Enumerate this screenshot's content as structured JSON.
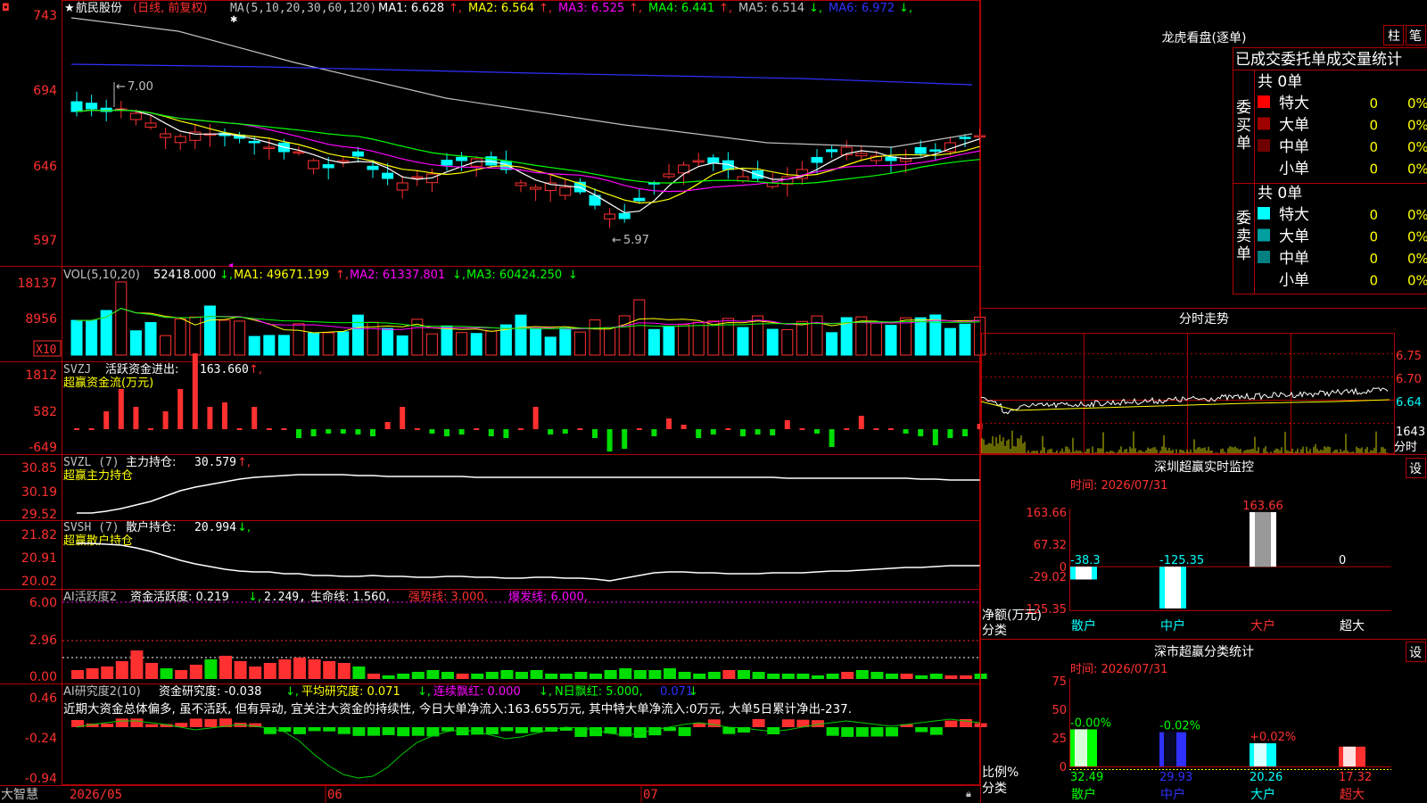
{
  "stock": {
    "star": "★",
    "name": "航民股份",
    "mode": "(日线, 前复权)"
  },
  "ma_legend": {
    "label": "MA(5,10,20,30,60,120)",
    "items": [
      {
        "text": "MA1: 6.628",
        "arrow": "↑",
        "color": "#ffffff"
      },
      {
        "text": "MA2: 6.564",
        "arrow": "↑",
        "color": "#ffff00"
      },
      {
        "text": "MA3: 6.525",
        "arrow": "↑",
        "color": "#ff00ff"
      },
      {
        "text": "MA4: 6.441",
        "arrow": "↑",
        "color": "#00ff00"
      },
      {
        "text": "MA5: 6.514",
        "arrow": "↓",
        "color": "#c0c0c0"
      },
      {
        "text": "MA6: 6.972",
        "arrow": "↓",
        "color": "#3030ff"
      }
    ]
  },
  "price_axis": [
    "743",
    "694",
    "646",
    "597"
  ],
  "price_marks": {
    "high": "7.00",
    "low": "5.97"
  },
  "vol_legend": {
    "label": "VOL(5,10,20)",
    "value": "52418.000",
    "ma1": "MA1: 49671.199",
    "ma2": "MA2: 61337.801",
    "ma3": "MA3: 60424.250"
  },
  "vol_axis": [
    "18137",
    "8956"
  ],
  "vol_unit": "X10",
  "svzj": {
    "label": "SVZJ",
    "title": "活跃资金进出:",
    "value": "163.660",
    "sub": "超赢资金流(万元)",
    "axis": [
      "1812",
      "582",
      "-649"
    ]
  },
  "svzl": {
    "label": "SVZL (7)",
    "title": "主力持仓:",
    "value": "30.579",
    "sub": "超赢主力持仓",
    "axis": [
      "30.85",
      "30.19",
      "29.52"
    ]
  },
  "svsh": {
    "label": "SVSH (7)",
    "title": "散户持仓:",
    "value": "20.994",
    "sub": "超赢散户持仓",
    "axis": [
      "21.82",
      "20.91",
      "20.02"
    ]
  },
  "ai_active": {
    "label": "AI活跃度2",
    "t1": "资金活跃度: 0.219",
    "t2": "2.249,",
    "t3": "生命线: 1.560,",
    "t4": "强势线: 3.000,",
    "t5": "爆发线: 6.000,",
    "axis": [
      "6.00",
      "2.96",
      "0.00"
    ]
  },
  "ai_research": {
    "label": "AI研究度2(10)",
    "t1": "资金研究度: -0.038",
    "t2": "平均研究度: 0.071",
    "t3": "连续飘红: 0.000",
    "t4": "N日飘红: 5.000,",
    "t5": "0.071",
    "axis": [
      "0.46",
      "-0.24",
      "-0.94"
    ],
    "comment": "近期大资金总体偏多, 虽不活跃, 但有异动, 宜关注大资金的持续性, 今日大单净流入:163.655万元, 其中特大单净流入:0万元, 大单5日累计净出-237."
  },
  "date_axis": [
    "2026/05",
    "06",
    "07"
  ],
  "brand": "大智慧",
  "right": {
    "lhb_title": "龙虎看盘(逐单)",
    "tab_zhu": "柱",
    "tab_bi": "笔",
    "stats_header": "已成交委托单成交量统计",
    "buy": {
      "side": "委买单",
      "total": "共 0单",
      "rows": [
        {
          "label": "特大",
          "count": "0",
          "pct": "0%",
          "color": "#ff0000"
        },
        {
          "label": "大单",
          "count": "0",
          "pct": "0%",
          "color": "#a00000"
        },
        {
          "label": "中单",
          "count": "0",
          "pct": "0%",
          "color": "#700000"
        },
        {
          "label": "小单",
          "count": "0",
          "pct": "0%",
          "color": "#000000"
        }
      ]
    },
    "sell": {
      "side": "委卖单",
      "total": "共 0单",
      "rows": [
        {
          "label": "特大",
          "count": "0",
          "pct": "0%",
          "color": "#00ffff"
        },
        {
          "label": "大单",
          "count": "0",
          "pct": "0%",
          "color": "#00a0a0"
        },
        {
          "label": "中单",
          "count": "0",
          "pct": "0%",
          "color": "#008080"
        },
        {
          "label": "小单",
          "count": "0",
          "pct": "0%",
          "color": "#000000"
        }
      ]
    },
    "intraday_title": "分时走势",
    "intraday_axis": [
      "6.75",
      "6.70",
      "6.64",
      "1643",
      "分时"
    ],
    "monitor_title": "深圳超赢实时监控",
    "setting": "设",
    "monitor_time": "时间: 2026/07/31",
    "monitor_axis": [
      "163.66",
      "67.32",
      "-29.02",
      "-125.35"
    ],
    "monitor_ylabel": "净额(万元)",
    "monitor_xlabel": "分类",
    "cls_stats_title": "深市超赢分类统计",
    "cls_time": "时间: 2026/07/31",
    "cls_axis": [
      "75",
      "50",
      "25",
      "0"
    ],
    "cls_ylabel": "比例%",
    "cls_xlabel": "分类"
  },
  "chart_data": [
    {
      "type": "bar",
      "title": "深圳超赢实时监控",
      "categories": [
        "散户",
        "中户",
        "大户",
        "超大"
      ],
      "values": [
        -38.3,
        -125.35,
        163.66,
        0
      ],
      "ylabel": "净额(万元)",
      "ylim": [
        -125.35,
        163.66
      ]
    },
    {
      "type": "bar",
      "title": "深市超赢分类统计",
      "categories": [
        "散户",
        "中户",
        "大户",
        "超大"
      ],
      "values": [
        32.49,
        29.93,
        20.26,
        17.32
      ],
      "changes": [
        "-0.00%",
        "-0.02%",
        "+0.02%",
        ""
      ],
      "ylabel": "比例%",
      "ylim": [
        0,
        75
      ]
    }
  ]
}
